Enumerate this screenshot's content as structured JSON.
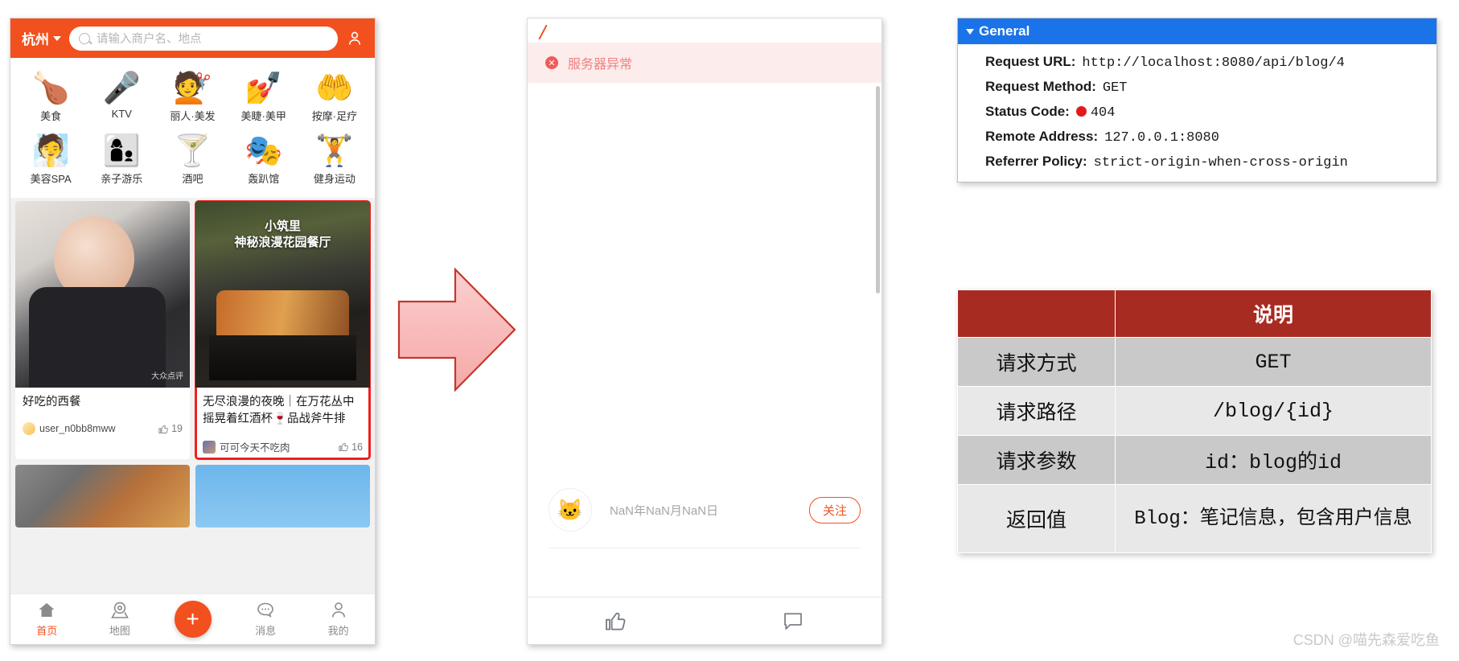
{
  "phone": {
    "header": {
      "city": "杭州",
      "search_placeholder": "请输入商户名、地点"
    },
    "categories": [
      {
        "label": "美食",
        "icon": "🍗"
      },
      {
        "label": "KTV",
        "icon": "🎤"
      },
      {
        "label": "丽人·美发",
        "icon": "💇"
      },
      {
        "label": "美睫·美甲",
        "icon": "💅"
      },
      {
        "label": "按摩·足疗",
        "icon": "🤲"
      },
      {
        "label": "美容SPA",
        "icon": "🧖"
      },
      {
        "label": "亲子游乐",
        "icon": "👩‍👦"
      },
      {
        "label": "酒吧",
        "icon": "🍸"
      },
      {
        "label": "轰趴馆",
        "icon": "🎭"
      },
      {
        "label": "健身运动",
        "icon": "🏋"
      }
    ],
    "cards": [
      {
        "title": "好吃的西餐",
        "overlay": "",
        "overlay2": "",
        "user": "user_n0bb8mww",
        "likes": "19",
        "watermark": "大众点评"
      },
      {
        "title": "无尽浪漫的夜晚｜在万花丛中摇晃着红酒杯🍷品战斧牛排",
        "overlay": "小筑里",
        "overlay2": "神秘浪漫花园餐厅",
        "user": "可可今天不吃肉",
        "likes": "16",
        "watermark": ""
      }
    ],
    "tabbar": [
      {
        "label": "首页",
        "icon": "home-icon",
        "active": true
      },
      {
        "label": "地图",
        "icon": "map-pin-icon",
        "active": false
      },
      {
        "label": "",
        "icon": "plus-icon",
        "active": false
      },
      {
        "label": "消息",
        "icon": "chat-icon",
        "active": false
      },
      {
        "label": "我的",
        "icon": "person-icon",
        "active": false
      }
    ],
    "fab_label": "+"
  },
  "middle": {
    "error_text": "服务器异常",
    "error_icon": "✕",
    "date_text": "NaN年NaN月NaN日",
    "follow_label": "关注",
    "avatar_icon": "🐱"
  },
  "general": {
    "title": "General",
    "rows": [
      {
        "key": "Request URL:",
        "value": "http://localhost:8080/api/blog/4",
        "status": false
      },
      {
        "key": "Request Method:",
        "value": "GET",
        "status": false
      },
      {
        "key": "Status Code:",
        "value": "404",
        "status": true
      },
      {
        "key": "Remote Address:",
        "value": "127.0.0.1:8080",
        "status": false
      },
      {
        "key": "Referrer Policy:",
        "value": "strict-origin-when-cross-origin",
        "status": false
      }
    ],
    "header_color": "#1a73e8",
    "status_color": "#e01b1b"
  },
  "table": {
    "header_left": "",
    "header_right": "说明",
    "rows": [
      {
        "key": "请求方式",
        "value": "GET"
      },
      {
        "key": "请求路径",
        "value": "/blog/{id}"
      },
      {
        "key": "请求参数",
        "value": "id：blog的id"
      },
      {
        "key": "返回值",
        "value": "Blog：笔记信息，包含用户信息"
      }
    ],
    "header_color": "#a82b22"
  },
  "watermark": "CSDN @喵先森爱吃鱼"
}
